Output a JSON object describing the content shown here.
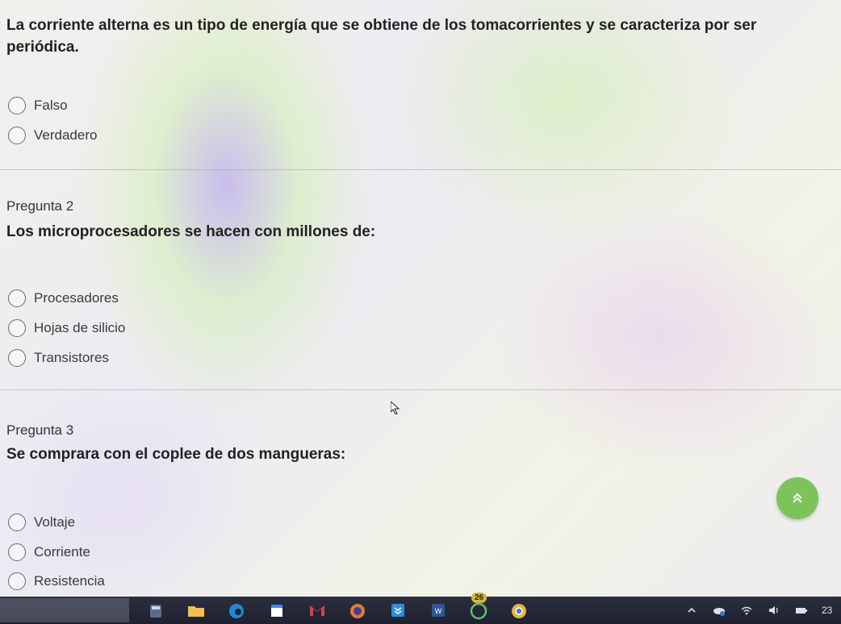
{
  "question1": {
    "text": "La corriente alterna es un tipo de energía que se obtiene de los tomacorrientes y  se caracteriza por ser periódica.",
    "options": [
      "Falso",
      "Verdadero"
    ]
  },
  "question2": {
    "heading": "Pregunta 2",
    "text": "Los microprocesadores se hacen con millones de:",
    "options": [
      "Procesadores",
      "Hojas de silicio",
      "Transistores"
    ]
  },
  "question3": {
    "heading": "Pregunta 3",
    "text": "Se comprara con el coplee de dos mangueras:",
    "options": [
      "Voltaje",
      "Corriente",
      "Resistencia"
    ]
  },
  "scroll_top": {
    "icon": "double-chevron-up-icon"
  },
  "taskbar": {
    "apps": [
      {
        "name": "calculator-app",
        "icon": "calculator-icon"
      },
      {
        "name": "file-explorer-app",
        "icon": "folder-icon"
      },
      {
        "name": "edge-app",
        "icon": "edge-icon"
      },
      {
        "name": "calendar-app",
        "icon": "calendar-icon"
      },
      {
        "name": "gmail-app",
        "icon": "gmail-icon"
      },
      {
        "name": "firefox-app",
        "icon": "firefox-icon"
      },
      {
        "name": "dropbox-app",
        "icon": "dropbox-icon"
      },
      {
        "name": "word-app",
        "icon": "word-icon"
      },
      {
        "name": "whatsapp-app",
        "icon": "whatsapp-icon",
        "badge": "26"
      },
      {
        "name": "chrome-app",
        "icon": "chrome-icon"
      }
    ],
    "clock": "23"
  },
  "colors": {
    "scroll_button": "#7cc45a",
    "taskbar": "#1d2130"
  }
}
